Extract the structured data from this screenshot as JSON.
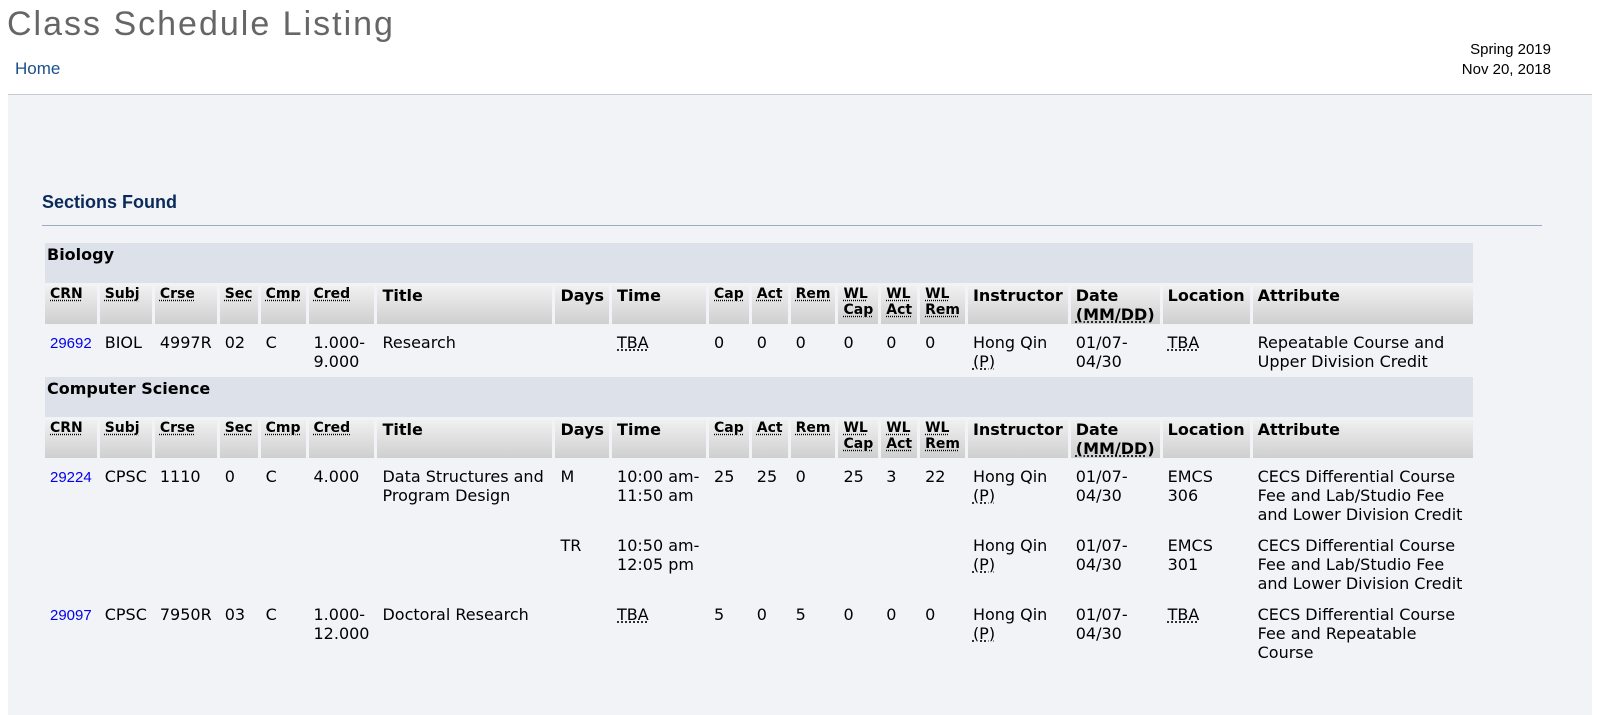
{
  "header": {
    "title": "Class Schedule Listing",
    "home_link": "Home",
    "term": "Spring 2019",
    "date": "Nov 20, 2018"
  },
  "sections_heading": "Sections Found",
  "columns": {
    "crn": "CRN",
    "subj": "Subj",
    "crse": "Crse",
    "sec": "Sec",
    "cmp": "Cmp",
    "cred": "Cred",
    "title": "Title",
    "days": "Days",
    "time": "Time",
    "cap": "Cap",
    "act": "Act",
    "rem": "Rem",
    "wl": "WL",
    "wl_cap": "Cap",
    "wl_act": "Act",
    "wl_rem": "Rem",
    "instructor": "Instructor",
    "date": "Date",
    "date_format": "(MM/DD)",
    "location": "Location",
    "attribute": "Attribute"
  },
  "subjects": [
    {
      "name": "Biology",
      "rows": [
        {
          "crn": "29692",
          "subj": "BIOL",
          "crse": "4997R",
          "sec": "02",
          "cmp": "C",
          "cred": "1.000-\n9.000",
          "title": "Research",
          "days": "",
          "time": "TBA",
          "cap": "0",
          "act": "0",
          "rem": "0",
          "wl_cap": "0",
          "wl_act": "0",
          "wl_rem": "0",
          "instructor": "Hong Qin",
          "instructor_flag": "(P)",
          "date": "01/07-\n04/30",
          "location": "TBA",
          "attribute": "Repeatable Course and\nUpper Division Credit"
        }
      ]
    },
    {
      "name": "Computer Science",
      "rows": [
        {
          "crn": "29224",
          "subj": "CPSC",
          "crse": "1110",
          "sec": "0",
          "cmp": "C",
          "cred": "4.000",
          "title": "Data Structures and\nProgram Design",
          "days": "M",
          "time": "10:00 am-\n11:50 am",
          "cap": "25",
          "act": "25",
          "rem": "0",
          "wl_cap": "25",
          "wl_act": "3",
          "wl_rem": "22",
          "instructor": "Hong Qin",
          "instructor_flag": "(P)",
          "date": "01/07-\n04/30",
          "location": "EMCS\n306",
          "attribute": "CECS Differential Course\nFee and Lab/Studio Fee\nand Lower Division Credit"
        },
        {
          "crn": "",
          "subj": "",
          "crse": "",
          "sec": "",
          "cmp": "",
          "cred": "",
          "title": "",
          "days": "TR",
          "time": "10:50 am-\n12:05 pm",
          "cap": "",
          "act": "",
          "rem": "",
          "wl_cap": "",
          "wl_act": "",
          "wl_rem": "",
          "instructor": "Hong Qin",
          "instructor_flag": "(P)",
          "date": "01/07-\n04/30",
          "location": "EMCS\n301",
          "attribute": "CECS Differential Course\nFee and Lab/Studio Fee\nand Lower Division Credit"
        },
        {
          "crn": "29097",
          "subj": "CPSC",
          "crse": "7950R",
          "sec": "03",
          "cmp": "C",
          "cred": "1.000-\n12.000",
          "title": "Doctoral Research",
          "days": "",
          "time": "TBA",
          "cap": "5",
          "act": "0",
          "rem": "5",
          "wl_cap": "0",
          "wl_act": "0",
          "wl_rem": "0",
          "instructor": "Hong Qin",
          "instructor_flag": "(P)",
          "date": "01/07-\n04/30",
          "location": "TBA",
          "attribute": "CECS Differential Course\nFee and Repeatable\nCourse"
        }
      ]
    }
  ]
}
